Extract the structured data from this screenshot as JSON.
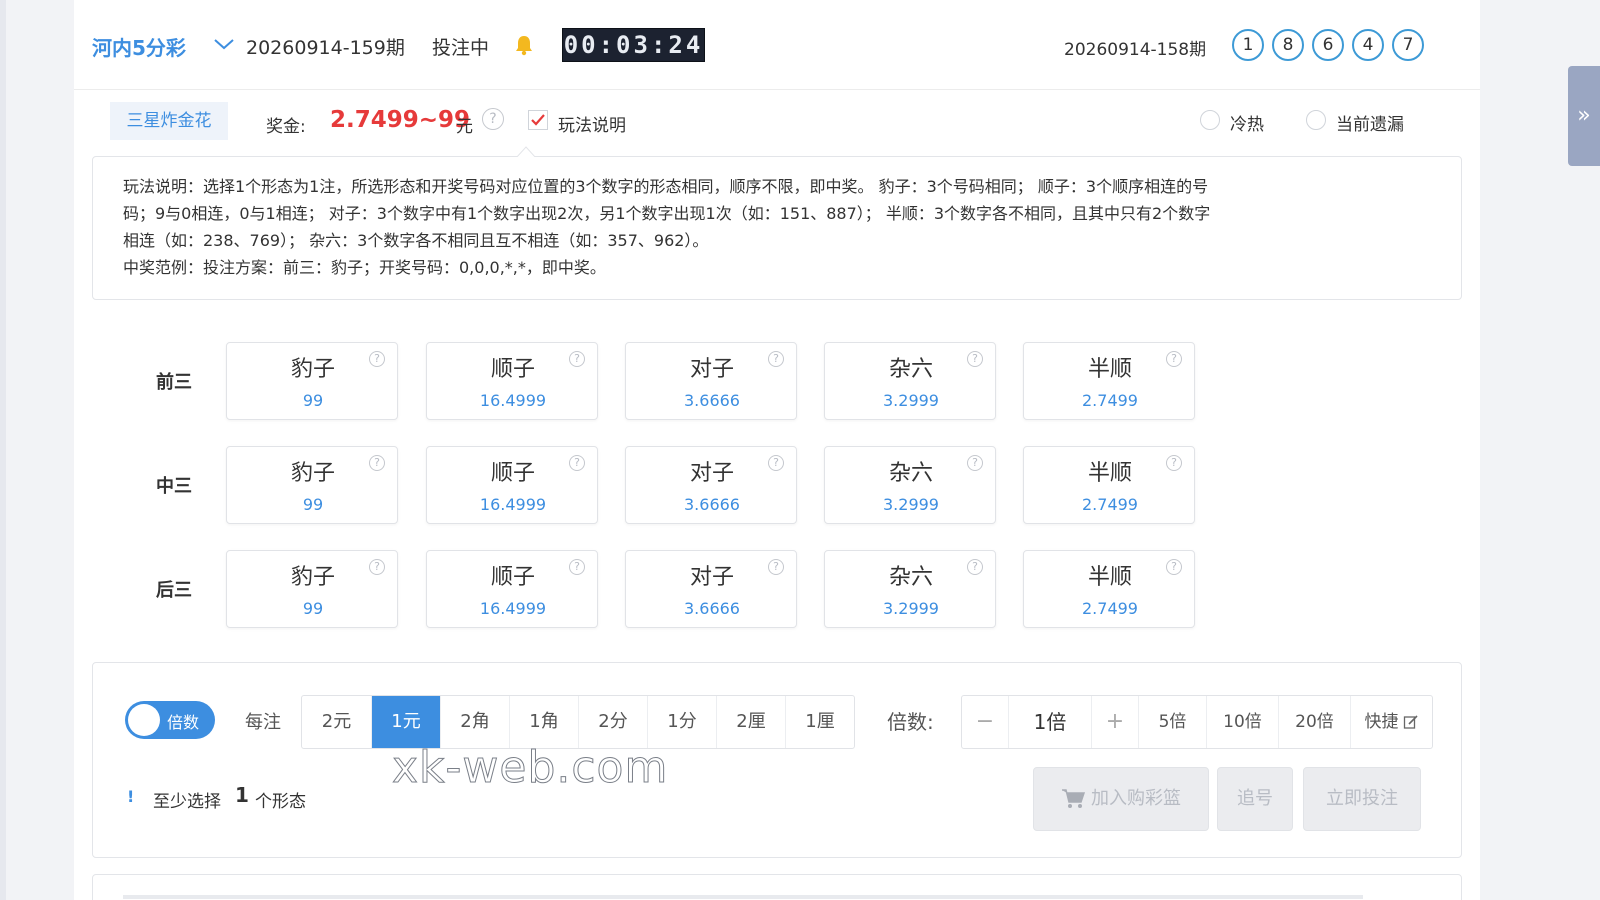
{
  "header": {
    "lottery_name": "河内5分彩",
    "current_period": "20260914-159期",
    "status": "投注中",
    "countdown": "00:03:24",
    "previous_period": "20260914-158期",
    "draw_numbers": [
      "1",
      "8",
      "6",
      "4",
      "7"
    ]
  },
  "play": {
    "active_tab": "三星炸金花",
    "bonus_label": "奖金:",
    "bonus_value": "2.7499~99",
    "bonus_unit": "元",
    "rules_checkbox_label": "玩法说明",
    "rules_checked": true,
    "option_hot_cold": "冷热",
    "option_missing": "当前遗漏"
  },
  "explanation": {
    "line1": "玩法说明：选择1个形态为1注，所选形态和开奖号码对应位置的3个数字的形态相同，顺序不限，即中奖。 豹子：3个号码相同； 顺子：3个顺序相连的号",
    "line2": "码；9与0相连，0与1相连； 对子：3个数字中有1个数字出现2次，另1个数字出现1次（如：151、887）； 半顺：3个数字各不相同，且其中只有2个数字",
    "line3": "相连（如：238、769）； 杂六：3个数字各不相同且互不相连（如：357、962）。",
    "line4": "中奖范例：投注方案：前三：豹子；开奖号码：0,0,0,*,*，即中奖。"
  },
  "grid": {
    "rows": [
      {
        "label": "前三",
        "cells": [
          {
            "name": "豹子",
            "odds": "99"
          },
          {
            "name": "顺子",
            "odds": "16.4999"
          },
          {
            "name": "对子",
            "odds": "3.6666"
          },
          {
            "name": "杂六",
            "odds": "3.2999"
          },
          {
            "name": "半顺",
            "odds": "2.7499"
          }
        ]
      },
      {
        "label": "中三",
        "cells": [
          {
            "name": "豹子",
            "odds": "99"
          },
          {
            "name": "顺子",
            "odds": "16.4999"
          },
          {
            "name": "对子",
            "odds": "3.6666"
          },
          {
            "name": "杂六",
            "odds": "3.2999"
          },
          {
            "name": "半顺",
            "odds": "2.7499"
          }
        ]
      },
      {
        "label": "后三",
        "cells": [
          {
            "name": "豹子",
            "odds": "99"
          },
          {
            "name": "顺子",
            "odds": "16.4999"
          },
          {
            "name": "对子",
            "odds": "3.6666"
          },
          {
            "name": "杂六",
            "odds": "3.2999"
          },
          {
            "name": "半顺",
            "odds": "2.7499"
          }
        ]
      }
    ],
    "help_glyph": "?"
  },
  "bet": {
    "toggle_label": "倍数",
    "unit_label": "每注",
    "units": [
      "2元",
      "1元",
      "2角",
      "1角",
      "2分",
      "1分",
      "2厘",
      "1厘"
    ],
    "active_unit_index": 1,
    "multiplier_label": "倍数:",
    "minus": "−",
    "multiplier_value": "1倍",
    "plus": "+",
    "quick_multipliers": [
      "5倍",
      "10倍",
      "20倍"
    ],
    "fast_label": "快捷",
    "warning_icon": "!",
    "warning_prefix": "至少选择",
    "warning_count": "1",
    "warning_suffix": "个形态",
    "add_to_cart": "加入购彩篮",
    "chase": "追号",
    "bet_now": "立即投注"
  },
  "watermark": "xk-web.com",
  "side_tab_glyph": "»",
  "colors": {
    "accent": "#3d8ee0",
    "bonus": "#e63a3a",
    "timer_bg": "#1c2230"
  }
}
